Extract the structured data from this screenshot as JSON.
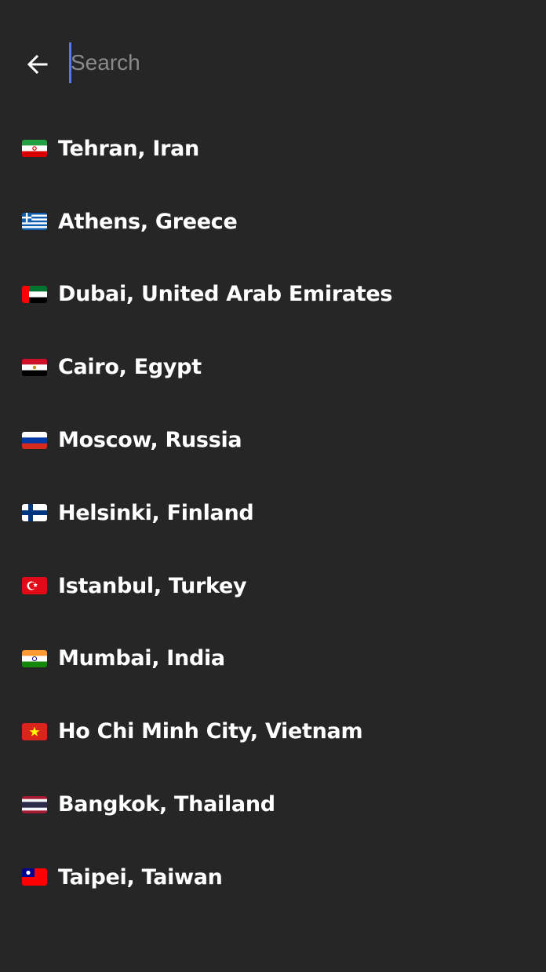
{
  "search": {
    "placeholder": "Search",
    "value": ""
  },
  "colors": {
    "background": "#262626",
    "accent": "#4f7bf2",
    "placeholder": "#8a8a8a",
    "text": "#ffffff"
  },
  "header": {
    "back_icon": "arrow-left-icon"
  },
  "cities": [
    {
      "label": "Tehran, Iran",
      "flag": "iran-flag-icon"
    },
    {
      "label": "Athens, Greece",
      "flag": "greece-flag-icon"
    },
    {
      "label": "Dubai, United Arab Emirates",
      "flag": "uae-flag-icon"
    },
    {
      "label": "Cairo, Egypt",
      "flag": "egypt-flag-icon"
    },
    {
      "label": "Moscow, Russia",
      "flag": "russia-flag-icon"
    },
    {
      "label": "Helsinki, Finland",
      "flag": "finland-flag-icon"
    },
    {
      "label": "Istanbul, Turkey",
      "flag": "turkey-flag-icon"
    },
    {
      "label": "Mumbai, India",
      "flag": "india-flag-icon"
    },
    {
      "label": "Ho Chi Minh City, Vietnam",
      "flag": "vietnam-flag-icon"
    },
    {
      "label": "Bangkok, Thailand",
      "flag": "thailand-flag-icon"
    },
    {
      "label": "Taipei, Taiwan",
      "flag": "taiwan-flag-icon"
    }
  ]
}
